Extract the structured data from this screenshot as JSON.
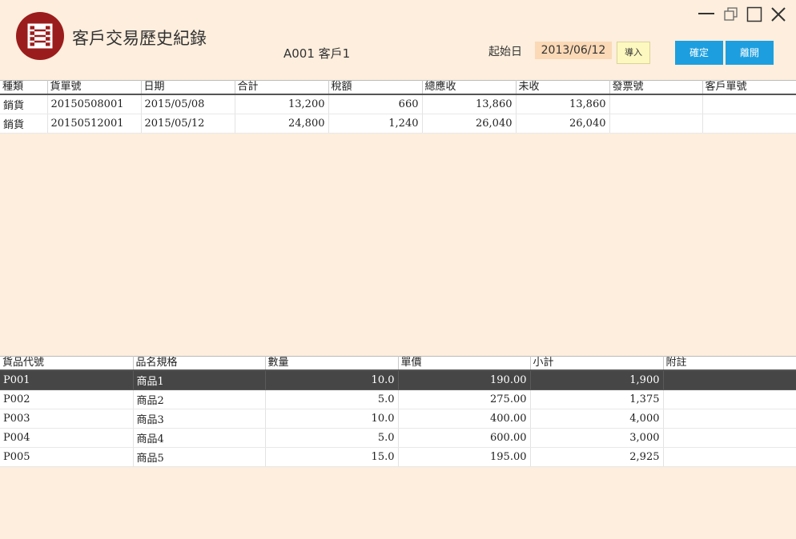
{
  "header": {
    "title": "客戶交易歷史紀錄",
    "customer": "A001 客戶1",
    "start_label": "起始日",
    "start_date": "2013/06/12",
    "import_label": "導入",
    "ok_label": "確定",
    "leave_label": "離開"
  },
  "icons": {
    "logo": "grid-logo-icon",
    "minimize": "minimize-icon",
    "restore": "restore-icon",
    "maximize": "maximize-icon",
    "close": "close-icon"
  },
  "colors": {
    "background": "#fdeedd",
    "logo": "#9b1c1c",
    "accent": "#1d9fdf",
    "selected_row": "#464646"
  },
  "transactions": {
    "columns": [
      "種類",
      "貨單號",
      "日期",
      "合計",
      "稅額",
      "總應收",
      "未收",
      "發票號",
      "客戶單號"
    ],
    "rows": [
      [
        "銷貨",
        "20150508001",
        "2015/05/08",
        "13,200",
        "660",
        "13,860",
        "13,860",
        "",
        ""
      ],
      [
        "銷貨",
        "20150512001",
        "2015/05/12",
        "24,800",
        "1,240",
        "26,040",
        "26,040",
        "",
        ""
      ]
    ]
  },
  "items": {
    "columns": [
      "貨品代號",
      "品名規格",
      "數量",
      "單價",
      "小計",
      "附註"
    ],
    "selected_index": 0,
    "rows": [
      [
        "P001",
        "商品1",
        "10.0",
        "190.00",
        "1,900",
        ""
      ],
      [
        "P002",
        "商品2",
        "5.0",
        "275.00",
        "1,375",
        ""
      ],
      [
        "P003",
        "商品3",
        "10.0",
        "400.00",
        "4,000",
        ""
      ],
      [
        "P004",
        "商品4",
        "5.0",
        "600.00",
        "3,000",
        ""
      ],
      [
        "P005",
        "商品5",
        "15.0",
        "195.00",
        "2,925",
        ""
      ]
    ]
  }
}
